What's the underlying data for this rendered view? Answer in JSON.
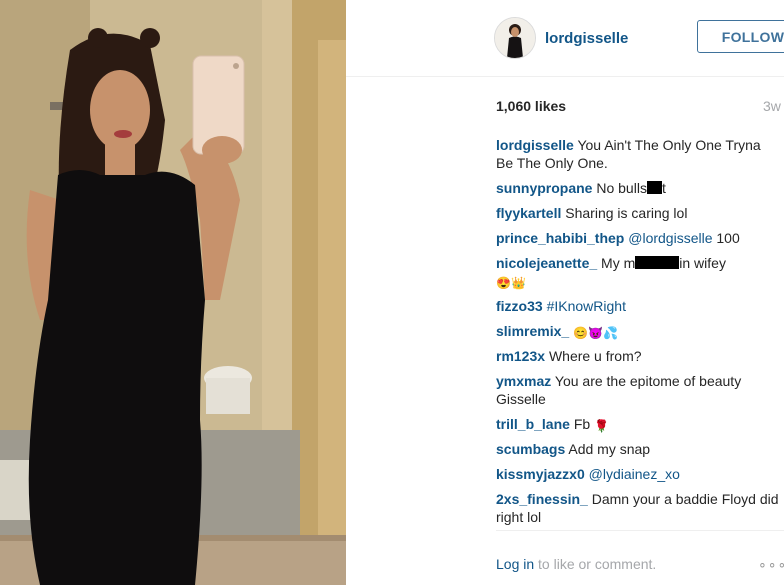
{
  "post": {
    "username": "lordgisselle",
    "follow_label": "FOLLOW",
    "likes": "1,060 likes",
    "time": "3w"
  },
  "comments": [
    {
      "user": "lordgisselle",
      "text": "You Ain't The Only One Tryna Be The Only One."
    },
    {
      "user": "sunnypropane",
      "text": "No bulls",
      "text_after": "t"
    },
    {
      "user": "flyykartell",
      "text": "Sharing is caring lol"
    },
    {
      "user": "prince_habibi_thep",
      "mention": "@lordgisselle",
      "text": "100"
    },
    {
      "user": "nicolejeanette_",
      "text": "My m",
      "text_after": "in wifey"
    },
    {
      "user": "fizzo33",
      "mention": "#IKnowRight"
    },
    {
      "user": "slimremix_",
      "text": ""
    },
    {
      "user": "rm123x",
      "text": "Where u from?"
    },
    {
      "user": "ymxmaz",
      "text": "You are the epitome of beauty Gisselle"
    },
    {
      "user": "trill_b_lane",
      "text": "Fb"
    },
    {
      "user": "scumbags",
      "text": "Add my snap"
    },
    {
      "user": "kissmyjazzx0",
      "mention": "@lydiainez_xo"
    },
    {
      "user": "2xs_finessin_",
      "text": "Damn your a baddie Floyd did right lol"
    }
  ],
  "footer": {
    "login_link": "Log in",
    "login_text": "to like or comment.",
    "more_glyph": "∘∘∘"
  },
  "icons": [
    "heart-eyes-emoji",
    "crown-emoji",
    "smiley-emoji",
    "devil-emoji",
    "droplets-emoji",
    "rose-emoji",
    "more-options-icon"
  ]
}
